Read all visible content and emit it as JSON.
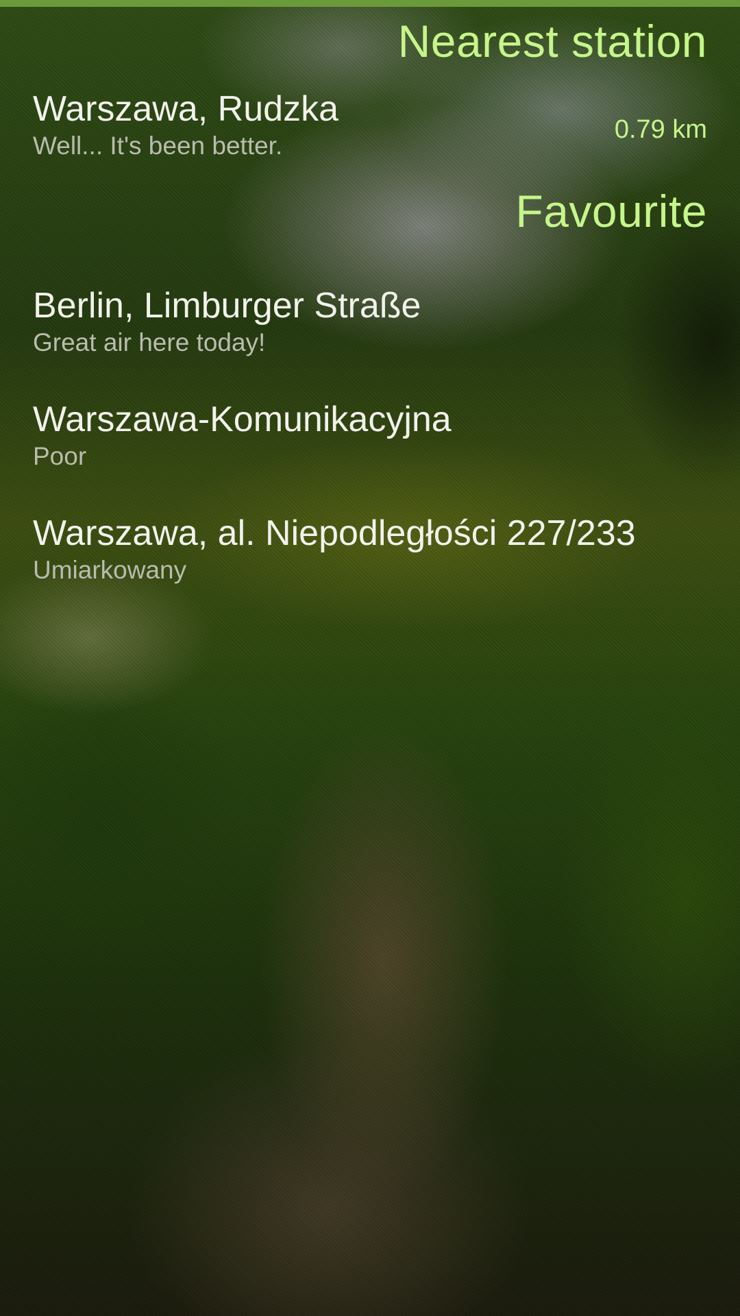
{
  "nearest": {
    "header": "Nearest station",
    "station": {
      "name": "Warszawa, Rudzka",
      "status": "Well... It's been better.",
      "distance": "0.79 km"
    }
  },
  "favourite": {
    "header": "Favourite",
    "stations": [
      {
        "name": "Berlin, Limburger Straße",
        "status": "Great air here today!"
      },
      {
        "name": "Warszawa-Komunikacyjna",
        "status": "Poor"
      },
      {
        "name": "Warszawa, al. Niepodległości 227/233",
        "status": "Umiarkowany"
      }
    ]
  },
  "colors": {
    "accent": "#c6f58a",
    "primary_text": "#f2f2ec",
    "secondary_text": "#b9bcae",
    "top_strip": "#6a9a3a"
  }
}
